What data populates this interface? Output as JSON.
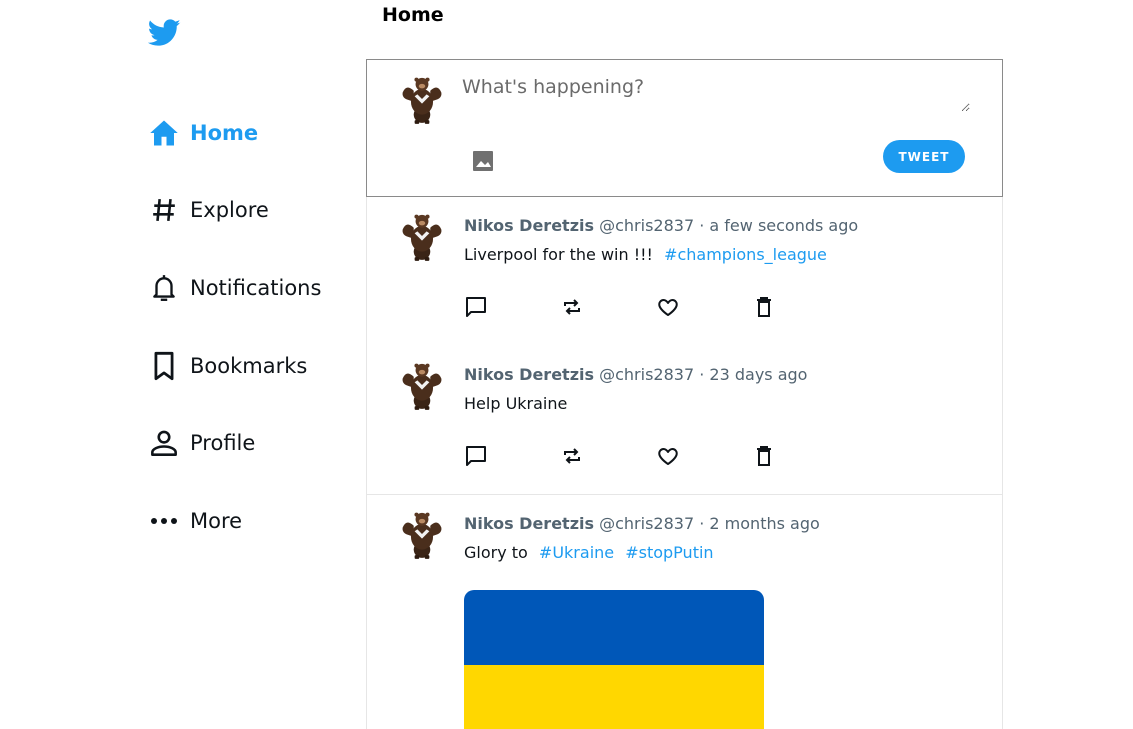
{
  "sidebar": {
    "logo_icon": "twitter-bird-icon",
    "items": [
      {
        "label": "Home",
        "icon": "home-icon",
        "active": true
      },
      {
        "label": "Explore",
        "icon": "hashtag-icon"
      },
      {
        "label": "Notifications",
        "icon": "bell-icon"
      },
      {
        "label": "Bookmarks",
        "icon": "bookmark-icon"
      },
      {
        "label": "Profile",
        "icon": "person-icon"
      },
      {
        "label": "More",
        "icon": "more-dots-icon"
      }
    ]
  },
  "header": {
    "title": "Home"
  },
  "composer": {
    "placeholder": "What's happening?",
    "button_label": "TWEET"
  },
  "tweets": [
    {
      "name": "Nikos Deretzis",
      "handle": "@chris2837",
      "time": "a few seconds ago",
      "text": "Liverpool for the win !!!",
      "hashtags": [
        "#champions_league"
      ]
    },
    {
      "name": "Nikos Deretzis",
      "handle": "@chris2837",
      "time": "23 days ago",
      "text": "Help Ukraine",
      "hashtags": []
    },
    {
      "name": "Nikos Deretzis",
      "handle": "@chris2837",
      "time": "2 months ago",
      "text": "Glory to",
      "hashtags": [
        "#Ukraine",
        "#stopPutin"
      ]
    }
  ],
  "colors": {
    "accent": "#1d9bf0",
    "flag_blue": "#0057b8",
    "flag_yellow": "#ffd700"
  }
}
